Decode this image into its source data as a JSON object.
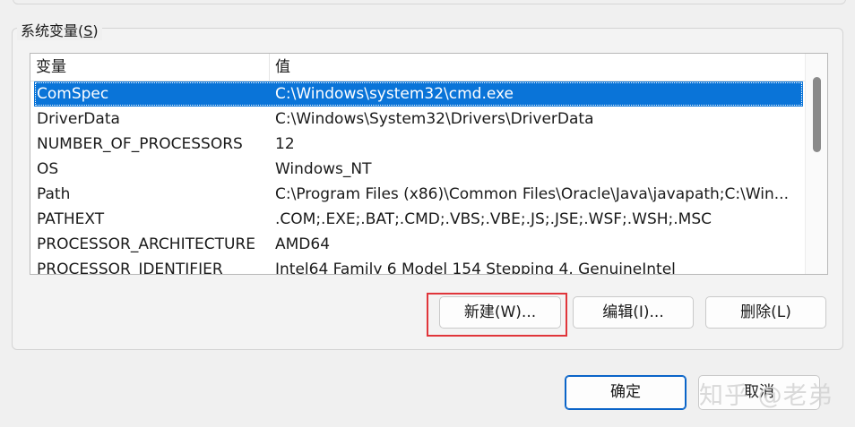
{
  "group": {
    "title_prefix": "系统变量(",
    "title_key": "S",
    "title_suffix": ")"
  },
  "table": {
    "columns": {
      "variable": "变量",
      "value": "值"
    },
    "rows": [
      {
        "name": "ComSpec",
        "value": "C:\\Windows\\system32\\cmd.exe",
        "selected": true
      },
      {
        "name": "DriverData",
        "value": "C:\\Windows\\System32\\Drivers\\DriverData"
      },
      {
        "name": "NUMBER_OF_PROCESSORS",
        "value": "12"
      },
      {
        "name": "OS",
        "value": "Windows_NT"
      },
      {
        "name": "Path",
        "value": "C:\\Program Files (x86)\\Common Files\\Oracle\\Java\\javapath;C:\\Win..."
      },
      {
        "name": "PATHEXT",
        "value": ".COM;.EXE;.BAT;.CMD;.VBS;.VBE;.JS;.JSE;.WSF;.WSH;.MSC"
      },
      {
        "name": "PROCESSOR_ARCHITECTURE",
        "value": "AMD64"
      },
      {
        "name": "PROCESSOR_IDENTIFIER",
        "value": "Intel64 Family 6 Model 154 Stepping 4, GenuineIntel"
      }
    ]
  },
  "buttons": {
    "new": "新建(W)...",
    "edit": "编辑(I)...",
    "delete": "删除(L)",
    "ok": "确定",
    "cancel": "取消"
  },
  "watermark": "知乎 @老弟",
  "colors": {
    "selection": "#0a74d8",
    "highlight": "#e0353a",
    "primary_border": "#0a64c8"
  }
}
